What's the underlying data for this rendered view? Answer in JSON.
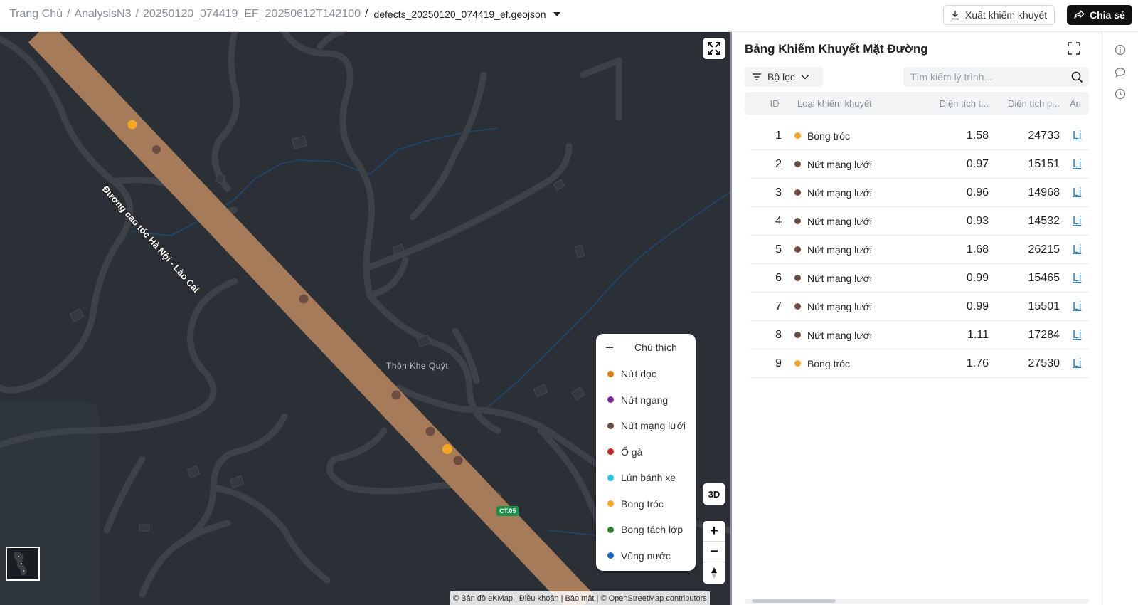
{
  "breadcrumb": {
    "home": "Trang Chủ",
    "project": "AnalysisN3",
    "run": "20250120_074419_EF_20250612T142100",
    "file": "defects_20250120_074419_ef.geojson"
  },
  "toolbar": {
    "export_label": "Xuất khiếm khuyết",
    "share_label": "Chia sẻ"
  },
  "map": {
    "road_label": "Đường cao tốc Hà Nội - Lào Cai",
    "place_label": "Thôn Khe Quýt",
    "route_shield": "CT.05",
    "btn_3d": "3D",
    "zoom_in": "+",
    "zoom_out": "−",
    "attribution": "© Bản đồ eKMap | Điều khoản | Bảo mật | © OpenStreetMap contributors",
    "colors": {
      "background": "#2b3036",
      "road": "#a57b5a",
      "minor_road": "#3d4248",
      "water": "#1f4770"
    }
  },
  "legend": {
    "title": "Chú thích",
    "items": [
      {
        "label": "Nứt dọc",
        "color": "#e07b12"
      },
      {
        "label": "Nứt ngang",
        "color": "#7b2fa0"
      },
      {
        "label": "Nứt mạng lưới",
        "color": "#6d4c41"
      },
      {
        "label": "Ổ gà",
        "color": "#c62828"
      },
      {
        "label": "Lún bánh xe",
        "color": "#26c6da"
      },
      {
        "label": "Bong tróc",
        "color": "#f5a623"
      },
      {
        "label": "Bong tách lớp",
        "color": "#2e7d32"
      },
      {
        "label": "Vũng nước",
        "color": "#1e66c8"
      }
    ]
  },
  "panel": {
    "title": "Bảng Khiếm Khuyết Mặt Đường",
    "filter_label": "Bộ lọc",
    "search_placeholder": "Tìm kiếm lý trình...",
    "columns": {
      "id": "ID",
      "type": "Loại khiếm khuyết",
      "area1": "Diện tích t...",
      "area2": "Diện tích p...",
      "image": "Ản"
    },
    "rows": [
      {
        "id": "1",
        "type": "Bong tróc",
        "color": "#f5a623",
        "area1": "1.58",
        "area2": "24733",
        "link": "Li"
      },
      {
        "id": "2",
        "type": "Nứt mạng lưới",
        "color": "#6d4c41",
        "area1": "0.97",
        "area2": "15151",
        "link": "Li"
      },
      {
        "id": "3",
        "type": "Nứt mạng lưới",
        "color": "#6d4c41",
        "area1": "0.96",
        "area2": "14968",
        "link": "Li"
      },
      {
        "id": "4",
        "type": "Nứt mạng lưới",
        "color": "#6d4c41",
        "area1": "0.93",
        "area2": "14532",
        "link": "Li"
      },
      {
        "id": "5",
        "type": "Nứt mạng lưới",
        "color": "#6d4c41",
        "area1": "1.68",
        "area2": "26215",
        "link": "Li"
      },
      {
        "id": "6",
        "type": "Nứt mạng lưới",
        "color": "#6d4c41",
        "area1": "0.99",
        "area2": "15465",
        "link": "Li"
      },
      {
        "id": "7",
        "type": "Nứt mạng lưới",
        "color": "#6d4c41",
        "area1": "0.99",
        "area2": "15501",
        "link": "Li"
      },
      {
        "id": "8",
        "type": "Nứt mạng lưới",
        "color": "#6d4c41",
        "area1": "1.11",
        "area2": "17284",
        "link": "Li"
      },
      {
        "id": "9",
        "type": "Bong tróc",
        "color": "#f5a623",
        "area1": "1.76",
        "area2": "27530",
        "link": "Li"
      }
    ]
  }
}
